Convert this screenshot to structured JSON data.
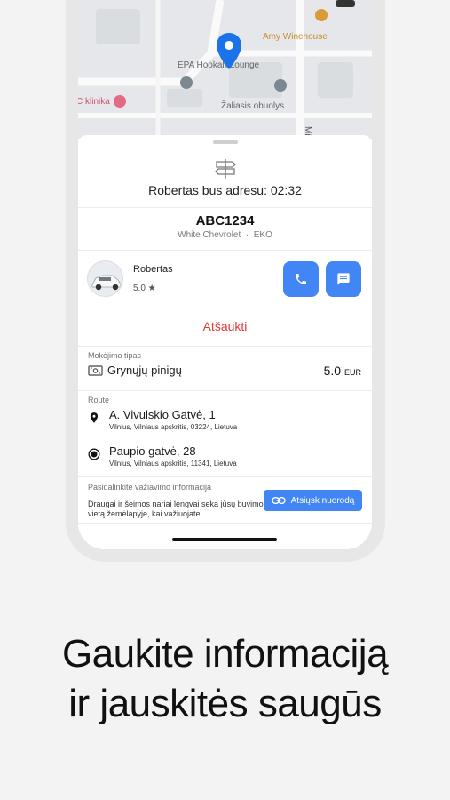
{
  "map": {
    "labels": {
      "amy": "Amy Winehouse",
      "hookah": "EPA Hookah Lounge",
      "zaliasis": "Žaliasis obuolys",
      "klinika": "C klinika",
      "street": "Mi"
    }
  },
  "trip": {
    "arrival_text": "Robertas bus adresu: 02:32",
    "plate": "ABC1234",
    "car_model": "White Chevrolet",
    "car_separator": "·",
    "car_class": "EKO"
  },
  "driver": {
    "name": "Robertas",
    "rating": "5.0 ★"
  },
  "actions": {
    "cancel_label": "Atšaukti"
  },
  "payment": {
    "label": "Mokėjimo tipas",
    "method": "Grynųjų pinigų",
    "price": "5.0",
    "currency": "EUR"
  },
  "route": {
    "label": "Route",
    "stops": [
      {
        "title": "A. Vivulskio Gatvė, 1",
        "subtitle": "Vilnius, Vilniaus apskritis, 03224, Lietuva"
      },
      {
        "title": "Paupio gatvė, 28",
        "subtitle": "Vilnius, Vilniaus apskritis, 11341, Lietuva"
      }
    ]
  },
  "share": {
    "label": "Pasidalinkite važiavimo informacija",
    "description": "Draugai ir šeimos nariai lengvai seka jūsų buvimo vietą žemėlapyje, kai važiuojate",
    "button_label": "Atsiųsk nuorodą"
  },
  "promo": {
    "line1": "Gaukite informaciją",
    "line2": "ir jauskitės saugūs"
  },
  "colors": {
    "accent": "#4285f4",
    "cancel": "#e53935",
    "map_pin": "#1a73e8"
  },
  "icons": [
    "signpost-icon",
    "phone-icon",
    "chat-icon",
    "cash-icon",
    "pin-icon",
    "destination-icon",
    "link-icon",
    "map-pin-icon"
  ]
}
